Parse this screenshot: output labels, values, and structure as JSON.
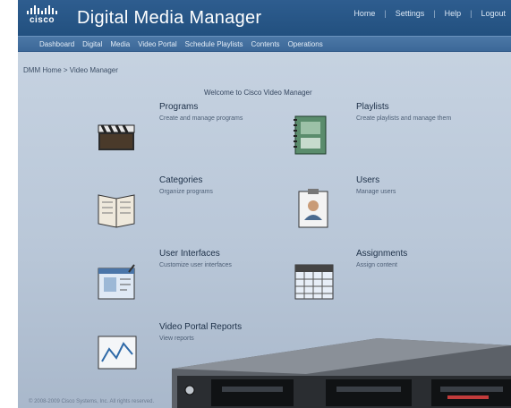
{
  "header": {
    "logo_text": "cisco",
    "app_title": "Digital Media Manager",
    "util_links": [
      "Home",
      "Settings",
      "Help",
      "Logout"
    ]
  },
  "nav": {
    "items": [
      "Dashboard",
      "Digital",
      "Media",
      "Video Portal",
      "Schedule Playlists",
      "Contents",
      "Operations"
    ]
  },
  "breadcrumb": "DMM Home > Video Manager",
  "welcome": "Welcome to Cisco Video Manager",
  "cards": {
    "programs": {
      "title": "Programs",
      "desc": "Create and manage programs"
    },
    "playlists": {
      "title": "Playlists",
      "desc": "Create playlists and manage them"
    },
    "categories": {
      "title": "Categories",
      "desc": "Organize programs"
    },
    "users": {
      "title": "Users",
      "desc": "Manage users"
    },
    "user_interfaces": {
      "title": "User Interfaces",
      "desc": "Customize user interfaces"
    },
    "assignments": {
      "title": "Assignments",
      "desc": "Assign content"
    },
    "usage_reports": {
      "title": "Video Portal Reports",
      "desc": "View reports"
    }
  },
  "footer": "© 2008-2009 Cisco Systems, Inc. All rights reserved.",
  "colors": {
    "header": "#22507f",
    "nav": "#3c6898",
    "content_bg": "#b9c7d8"
  }
}
